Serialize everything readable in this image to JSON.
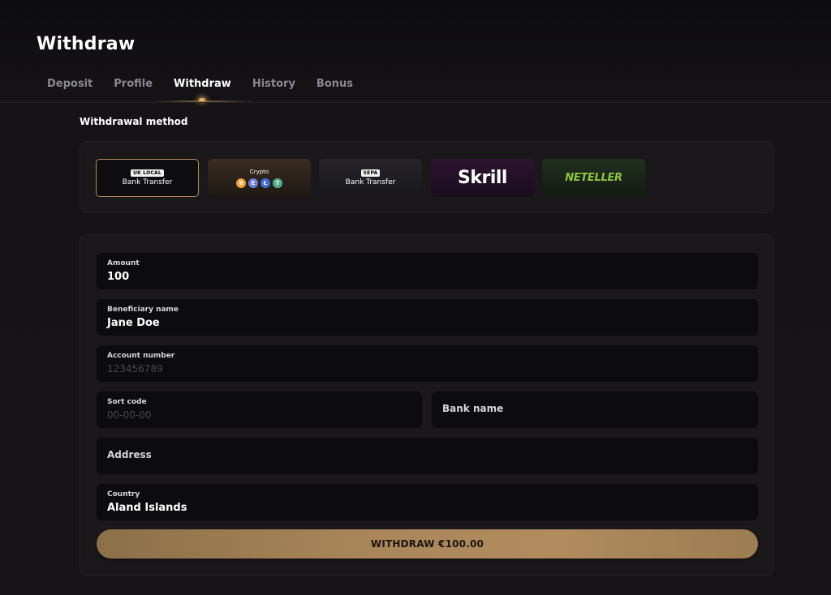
{
  "page": {
    "title": "Withdraw"
  },
  "tabs": [
    {
      "label": "Deposit"
    },
    {
      "label": "Profile"
    },
    {
      "label": "Withdraw",
      "active": true
    },
    {
      "label": "History"
    },
    {
      "label": "Bonus"
    }
  ],
  "section": {
    "label": "Withdrawal method"
  },
  "methods": {
    "uk": {
      "tag": "UK LOCAL",
      "label": "Bank Transfer",
      "selected": true
    },
    "crypto": {
      "label": "Crypto",
      "coins": [
        "B",
        "E",
        "Ł",
        "T"
      ]
    },
    "sepa": {
      "tag": "SEPA",
      "label": "Bank Transfer"
    },
    "skrill": {
      "label": "Skrill"
    },
    "neteller": {
      "label": "NETELLER"
    }
  },
  "form": {
    "amount": {
      "label": "Amount",
      "value": "100"
    },
    "beneficiary": {
      "label": "Beneficiary name",
      "value": "Jane Doe"
    },
    "account": {
      "label": "Account number",
      "placeholder": "123456789"
    },
    "sort_code": {
      "label": "Sort code",
      "placeholder": "00-00-00"
    },
    "bank_name": {
      "placeholder": "Bank name"
    },
    "address": {
      "placeholder": "Address"
    },
    "country": {
      "label": "Country",
      "value": "Aland Islands"
    },
    "submit_label": "WITHDRAW €100.00"
  },
  "colors": {
    "accent": "#b88e56",
    "button_gold": "#a9865a",
    "neteller_green": "#8dc63f",
    "background": "#121013"
  }
}
